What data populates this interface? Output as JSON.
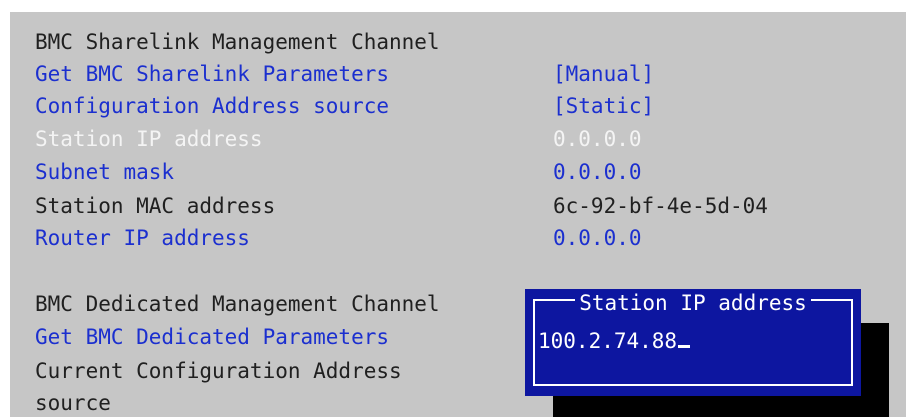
{
  "sharelink": {
    "header": "BMC Sharelink Management Channel",
    "rows": [
      {
        "label": "Get BMC Sharelink Parameters",
        "value": "[Manual]"
      },
      {
        "label": "Configuration Address source",
        "value": "[Static]"
      },
      {
        "label": "Station IP address",
        "value": "0.0.0.0"
      },
      {
        "label": "Subnet mask",
        "value": "0.0.0.0"
      },
      {
        "label": "Station MAC address",
        "value": "6c-92-bf-4e-5d-04"
      },
      {
        "label": "Router IP address",
        "value": "0.0.0.0"
      }
    ]
  },
  "dedicated": {
    "header": "BMC Dedicated Management Channel",
    "rows": [
      {
        "label": "Get BMC Dedicated Parameters"
      },
      {
        "label": "Current Configuration Address"
      },
      {
        "label": "source"
      }
    ]
  },
  "popup": {
    "title": "Station IP address",
    "input_value": "100.2.74.88"
  },
  "colors": {
    "background": "#c6c6c6",
    "selectable_text": "#1b2fcf",
    "highlight_text": "#f4f4f4",
    "static_text": "#202020",
    "popup_background": "#0d16a0"
  }
}
